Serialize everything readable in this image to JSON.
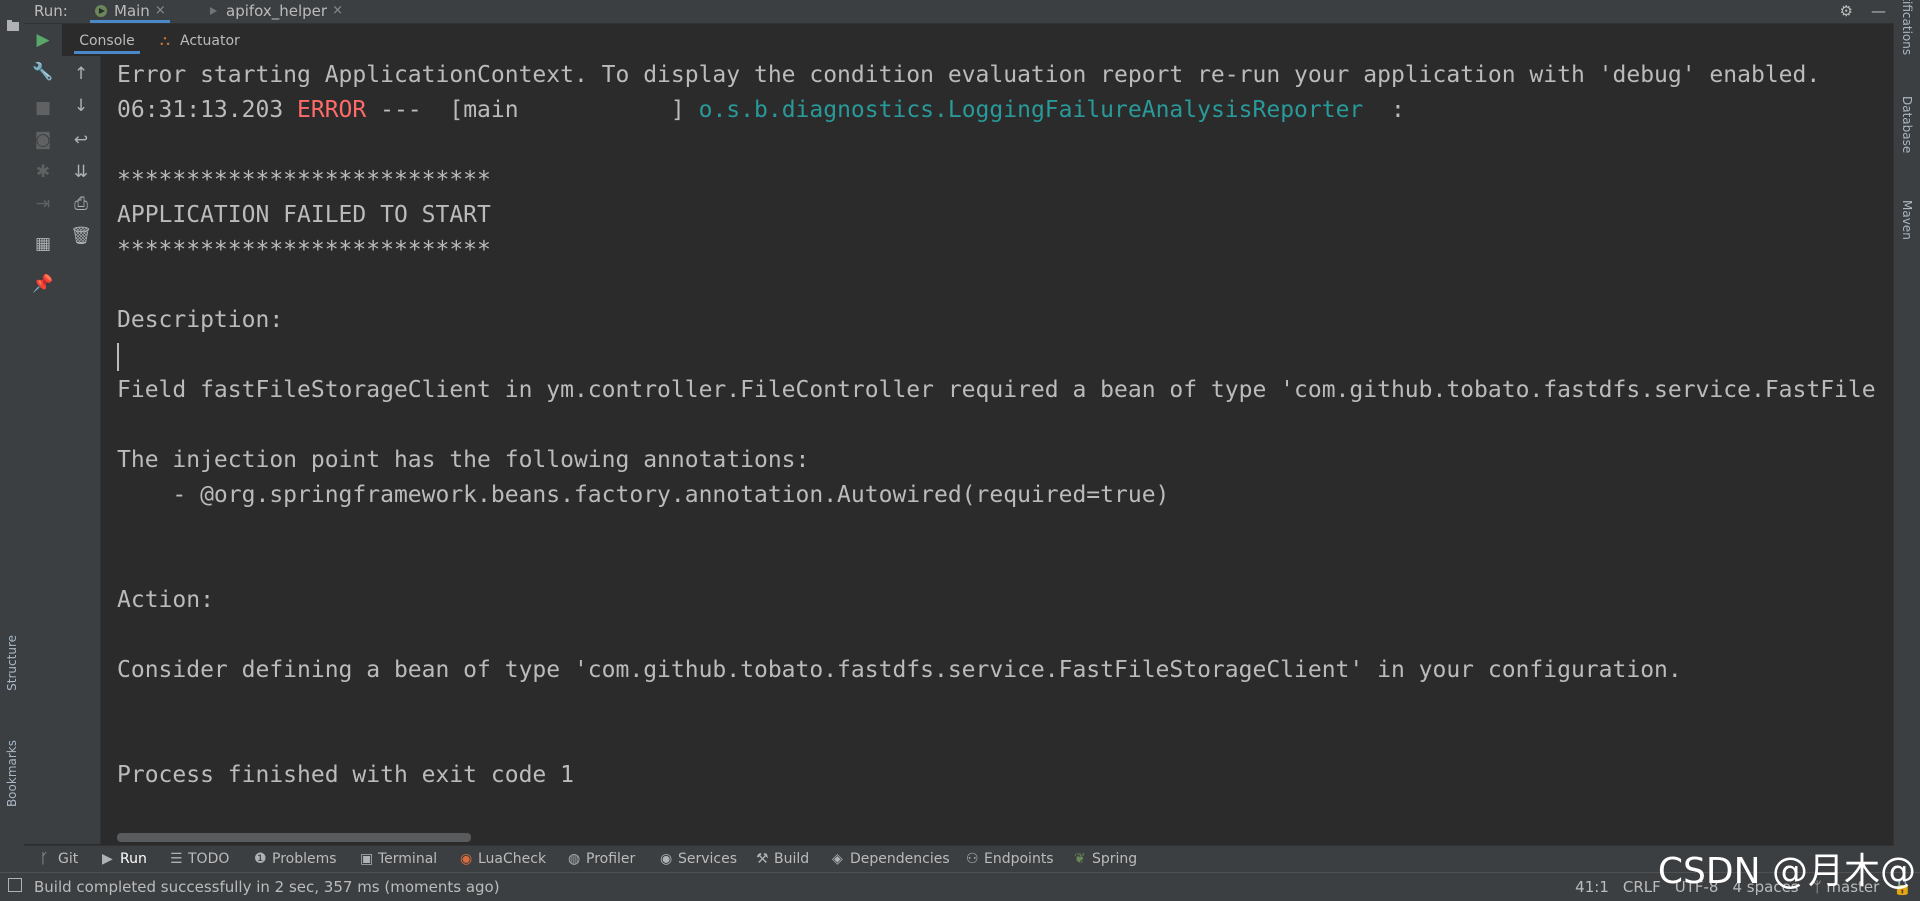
{
  "run_header": {
    "label": "Run:",
    "tabs": [
      {
        "label": "Main",
        "close": "×",
        "active": true
      },
      {
        "label": "apifox_helper",
        "close": "×",
        "active": false
      }
    ]
  },
  "sub_tabs": [
    {
      "label": "Console",
      "active": true
    },
    {
      "label": "Actuator",
      "active": false
    }
  ],
  "left_stripe": {
    "structure": "Structure",
    "bookmarks": "Bookmarks"
  },
  "right_stripe": {
    "notifications": "Notifications",
    "database": "Database",
    "maven": "Maven"
  },
  "console": {
    "line1": "Error starting ApplicationContext. To display the condition evaluation report re-run your application with 'debug' enabled.",
    "line2_time": "06:31:13.203 ",
    "line2_level": "ERROR",
    "line2_mid": " ---  [main           ] ",
    "line2_logger": "o.s.b.diagnostics.LoggingFailureAnalysisReporter",
    "line2_end": "  :",
    "stars1": "***************************",
    "failed": "APPLICATION FAILED TO START",
    "stars2": "***************************",
    "description": "Description:",
    "field_line": "Field fastFileStorageClient in ym.controller.FileController required a bean of type 'com.github.tobato.fastdfs.service.FastFile",
    "injection": "The injection point has the following annotations:",
    "annotation": "    - @org.springframework.beans.factory.annotation.Autowired(required=true)",
    "action": "Action:",
    "consider": "Consider defining a bean of type 'com.github.tobato.fastdfs.service.FastFileStorageClient' in your configuration.",
    "process": "Process finished with exit code 1"
  },
  "bottom_bar": [
    {
      "label": "Git",
      "icon": "git-icon"
    },
    {
      "label": "Run",
      "icon": "run-icon",
      "active": true
    },
    {
      "label": "TODO",
      "icon": "list-icon"
    },
    {
      "label": "Problems",
      "icon": "problems-icon"
    },
    {
      "label": "Terminal",
      "icon": "terminal-icon"
    },
    {
      "label": "LuaCheck",
      "icon": "luacheck-icon"
    },
    {
      "label": "Profiler",
      "icon": "profiler-icon"
    },
    {
      "label": "Services",
      "icon": "services-icon"
    },
    {
      "label": "Build",
      "icon": "hammer-icon"
    },
    {
      "label": "Dependencies",
      "icon": "dependencies-icon"
    },
    {
      "label": "Endpoints",
      "icon": "endpoints-icon"
    },
    {
      "label": "Spring",
      "icon": "spring-icon"
    }
  ],
  "status": {
    "message": "Build completed successfully in 2 sec, 357 ms (moments ago)",
    "position": "41:1",
    "line_sep": "CRLF",
    "encoding": "UTF-8",
    "indent": "4 spaces",
    "branch": "master"
  },
  "watermark": "CSDN @月木@",
  "colors": {
    "error": "#ff6b68",
    "logger": "#299999",
    "accent": "#4a88c7"
  }
}
